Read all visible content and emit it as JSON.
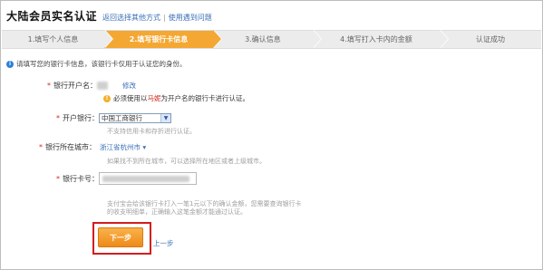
{
  "header": {
    "title": "大陆会员实名认证",
    "link_other": "返回选择其他方式",
    "separator": "|",
    "link_help": "使用遇到问题"
  },
  "steps": [
    {
      "label": "1.填写个人信息",
      "active": false
    },
    {
      "label": "2.填写银行卡信息",
      "active": true
    },
    {
      "label": "3.确认信息",
      "active": false
    },
    {
      "label": "4.填写打入卡内的金额",
      "active": false
    },
    {
      "label": "认证成功",
      "active": false
    }
  ],
  "notice": "请填写您的银行卡信息，该银行卡仅用于认证您的身份。",
  "form": {
    "account_name": {
      "label": "银行开户名：",
      "edit_link": "修改",
      "warning_prefix": "必须使用以",
      "warning_highlight": "马妮",
      "warning_suffix": "为开户名的银行卡进行认证。"
    },
    "bank": {
      "label": "开户银行：",
      "value": "中国工商银行",
      "hint": "不支持信用卡和存折进行认证。"
    },
    "city": {
      "label": "银行所在城市：",
      "value": "浙江省杭州市",
      "hint": "如果找不到所在城市，可以选择所在地区或者上级城市。"
    },
    "card_number": {
      "label": "银行卡号：",
      "hint_line1": "支付宝会给该银行卡打入一笔1元以下的确认金额，您需要查询银行卡",
      "hint_line2": "的收支明细单，正确输入这笔金额才能通过认证。"
    }
  },
  "actions": {
    "next_label": "下一步",
    "prev_label": "上一步"
  },
  "colors": {
    "active_step": "#f4a732",
    "link": "#3a6fb7",
    "required": "#d12a1f",
    "highlight_box": "#d41d1d"
  }
}
